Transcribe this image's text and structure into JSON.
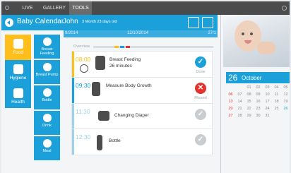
{
  "topbar": {
    "tabs": [
      "LIVE",
      "GALLERY",
      "TOOLS"
    ]
  },
  "header": {
    "title": "Baby Calendar",
    "name": "John",
    "age": "3 Month 23 days old"
  },
  "datebar": {
    "left": "9/2014",
    "center": "12/10/2014",
    "right": "27/1"
  },
  "sidebar": {
    "categories": [
      "Food",
      "Hygiene",
      "Health"
    ],
    "subitems": [
      "Breast Feeding",
      "Breast Pump",
      "Bottle",
      "Drink",
      "Meal"
    ]
  },
  "timeline": {
    "overview_label": "Overview",
    "events": [
      {
        "time": "08:00",
        "label": "Breast Feeding",
        "sub": "26 minutes",
        "status": "Done",
        "status_icon": "check-icon"
      },
      {
        "time": "09:30",
        "label": "Measure Body Growth",
        "sub": "",
        "status": "Missed",
        "status_icon": "x-icon"
      },
      {
        "time": "11:30",
        "label": "Changing Diaper",
        "sub": "",
        "status": "",
        "status_icon": "check-icon"
      },
      {
        "time": "12:30",
        "label": "Bottle",
        "sub": "",
        "status": "",
        "status_icon": "check-icon"
      }
    ]
  },
  "calendar": {
    "day": "26",
    "month": "October",
    "rows": [
      [
        "",
        "",
        "01",
        "02",
        "03",
        "04",
        "05"
      ],
      [
        "06",
        "07",
        "08",
        "09",
        "10",
        "11",
        "12"
      ],
      [
        "13",
        "14",
        "15",
        "16",
        "17",
        "18",
        "19"
      ],
      [
        "20",
        "21",
        "22",
        "23",
        "24",
        "25",
        "26"
      ],
      [
        "27",
        "28",
        "29",
        "30",
        "31",
        "",
        ""
      ]
    ]
  },
  "colors": {
    "accent": "#1ba0d9",
    "highlight": "#ffbe1a",
    "done": "#1ba0d9",
    "missed": "#e5322d",
    "pending": "#c9cdd0"
  }
}
